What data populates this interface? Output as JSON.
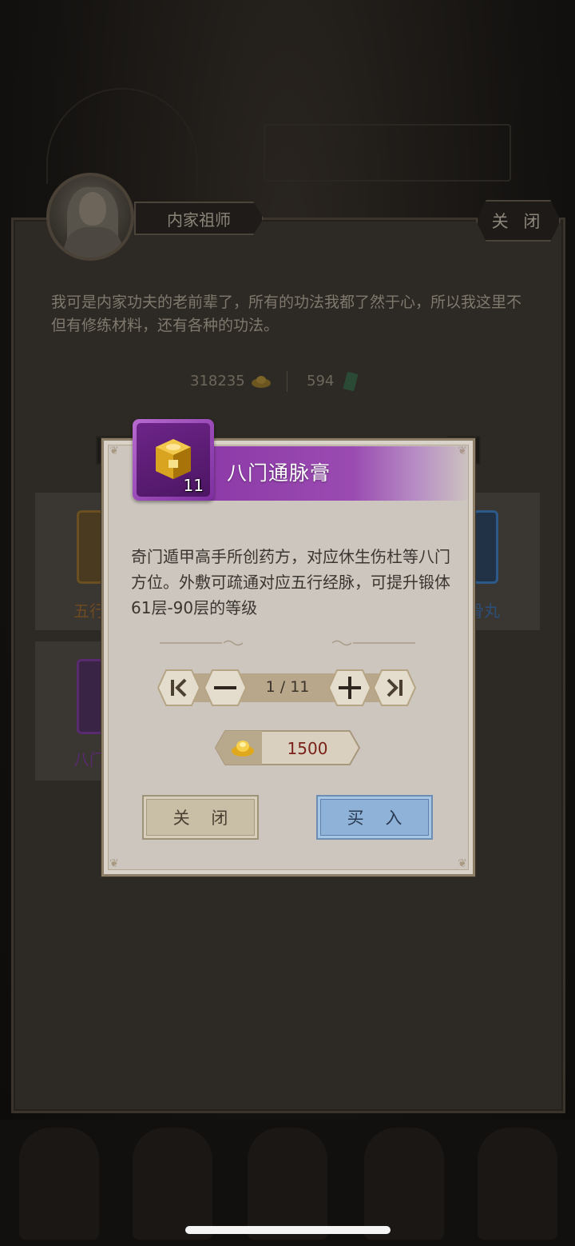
{
  "shop": {
    "npc_name": "内家祖师",
    "close_label": "关 闭",
    "speech": "我可是内家功夫的老前辈了，所有的功法我都了然于心，所以我这里不但有修练材料，还有各种的功法。",
    "gold_amount": "318235",
    "jade_amount": "594",
    "items": [
      {
        "label": "五行"
      },
      {
        "label": "骨丸"
      },
      {
        "label": "八门"
      }
    ]
  },
  "modal": {
    "item_name": "八门通脉膏",
    "item_count": "11",
    "description": "奇门遁甲高手所创药方，对应休生伤杜等八门方位。外敷可疏通对应五行经脉，可提升锻体61层-90层的等级",
    "quantity": "1 / 11",
    "price": "1500",
    "close_label": "关 闭",
    "buy_label": "买 入"
  },
  "colors": {
    "item_rarity": "#8d3aa8",
    "buy_button": "#8fb3d8",
    "price_text": "#7a2118"
  }
}
